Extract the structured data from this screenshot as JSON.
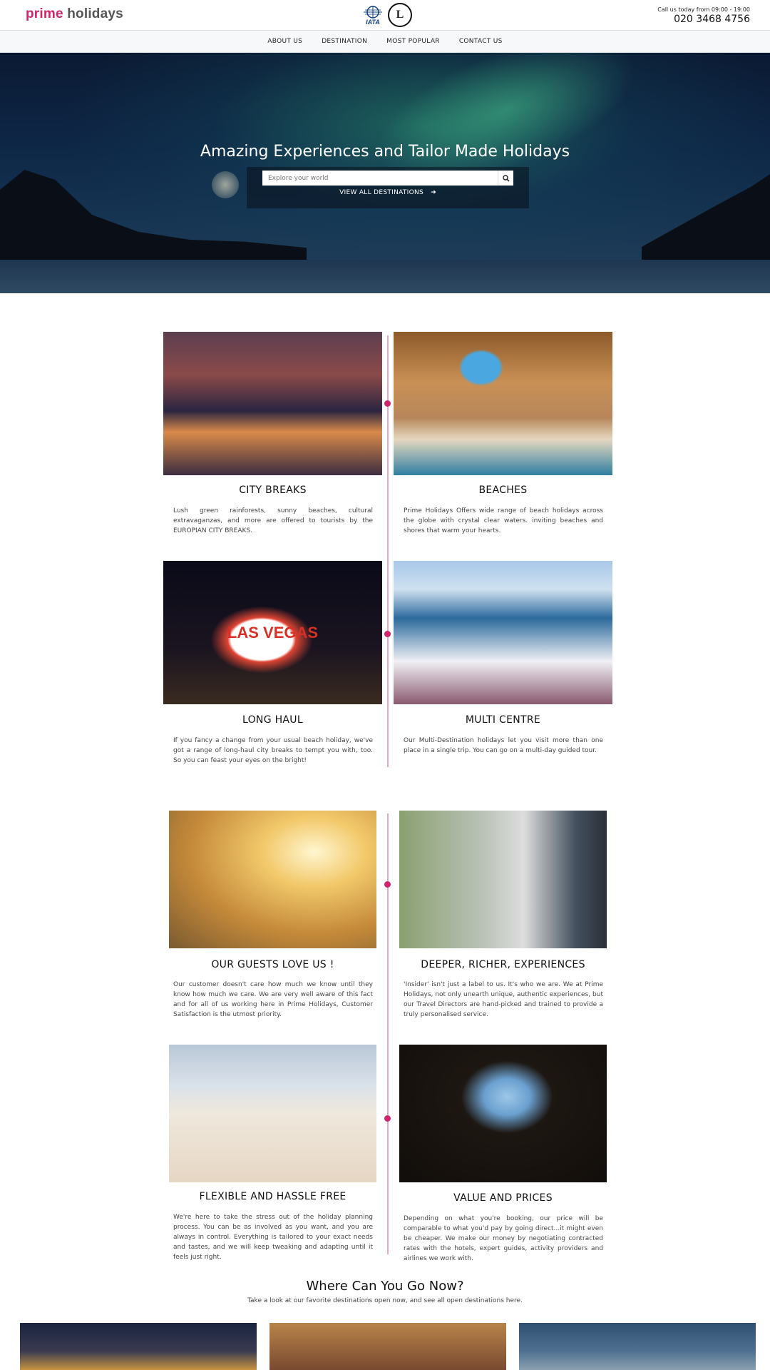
{
  "header": {
    "logo_part1": "prime",
    "logo_part2": "holidays",
    "iata_label": "IATA",
    "atol_label": "L",
    "call_text": "Call us today from 09:00 - 19:00",
    "phone": "020 3468 4756"
  },
  "nav": [
    "ABOUT US",
    "DESTINATION",
    "MOST POPULAR",
    "CONTACT US"
  ],
  "hero": {
    "title": "Amazing Experiences and Tailor Made Holidays",
    "search_placeholder": "Explore your world",
    "view_all": "VIEW ALL DESTINATIONS",
    "search_icon": "search-icon",
    "arrow_icon": "arrow-right-icon"
  },
  "section1": [
    {
      "title": "CITY BREAKS",
      "text": "Lush green rainforests, sunny beaches, cultural extravaganzas, and more are offered to tourists by the EUROPIAN CITY BREAKS."
    },
    {
      "title": "BEACHES",
      "text": "Prime Holidays Offers wide range of beach holidays across the globe with crystal clear waters. inviting beaches and shores that warm your hearts."
    },
    {
      "title": "LONG HAUL",
      "text": "If you fancy a change from your usual beach holiday, we've got a range of long-haul city breaks to tempt you with, too. So you can feast your eyes on the bright!"
    },
    {
      "title": "MULTI CENTRE",
      "text": "Our Multi-Destination holidays let you visit more than one place in a single trip. You can go on a multi-day guided tour."
    }
  ],
  "vegas_sign": "LAS VEGAS",
  "section2": [
    {
      "title": "OUR GUESTS LOVE US !",
      "text": "Our customer doesn't care how much we know until they know how much we care. We are very well aware of this fact and for all of us working here in Prime Holidays, Customer Satisfaction is the utmost priority."
    },
    {
      "title": "DEEPER, RICHER, EXPERIENCES",
      "text": "'Insider' isn't just a label to us. It's who we are. We at Prime Holidays, not only unearth unique, authentic experiences, but our Travel Directors are hand-picked and trained to provide a truly personalised service."
    },
    {
      "title": "FLEXIBLE AND HASSLE FREE",
      "text": "We're here to take the stress out of the holiday planning process. You can be as involved as you want, and you are always in control. Everything is tailored to your exact needs and tastes, and we will keep tweaking and adapting until it feels just right."
    },
    {
      "title": "VALUE AND PRICES",
      "text": "Depending on what you're booking, our price will be comparable to what you'd pay by going direct...it might even be cheaper. We make our money by negotiating contracted rates with the hotels, expert guides, activity providers and airlines we work with."
    }
  ],
  "where": {
    "title": "Where Can You Go Now?",
    "subtitle": "Take a look at our favorite destinations open now, and see all open destinations here."
  },
  "colors": {
    "brand_pink": "#d1246c",
    "timeline": "#e7a9c2"
  }
}
